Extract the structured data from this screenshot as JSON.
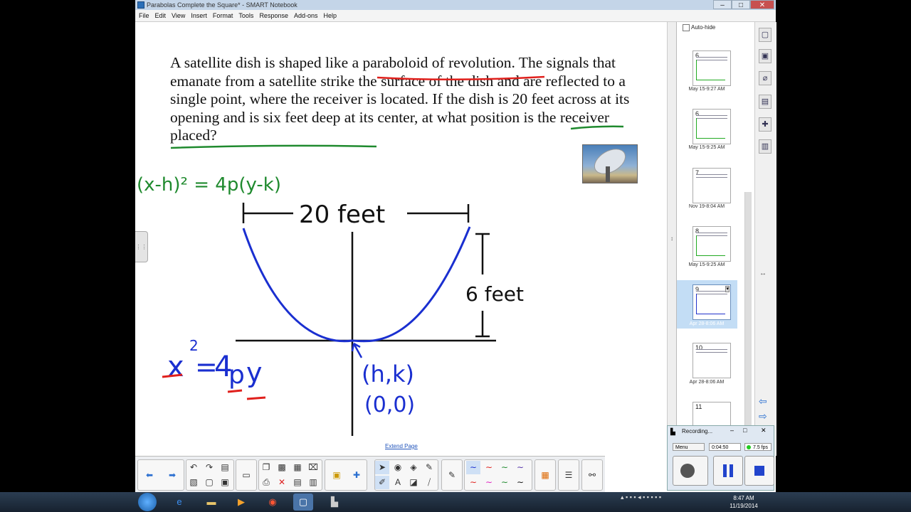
{
  "window": {
    "title": "Parabolas Complete the Square* - SMART Notebook",
    "minimize": "–",
    "maximize": "□",
    "close": "✕"
  },
  "menu": [
    "File",
    "Edit",
    "View",
    "Insert",
    "Format",
    "Tools",
    "Response",
    "Add-ons",
    "Help"
  ],
  "page": {
    "problem_text": "A satellite dish is shaped like a paraboloid of revolution. The signals that emanate from a satellite strike the surface of the dish and are reflected to a single point, where the receiver is located. If the dish is 20 feet across at its opening and is six feet deep at its center, at what position is the receiver placed?",
    "extend_page": "Extend Page",
    "handwriting": {
      "vertex_form": "(x-h)² = 4p(y-k)",
      "width_label": "20 feet",
      "depth_label": "6 feet",
      "standard_form_x": "x",
      "standard_form_exp": "2",
      "standard_form_eq": "=",
      "standard_form_4": "4",
      "standard_form_p": "p",
      "standard_form_y": "y",
      "vertex_hk": "(h,k)",
      "vertex_00": "(0,0)"
    },
    "colors": {
      "green": "#1f8a2e",
      "blue": "#1a2fd0",
      "red": "#e0201c",
      "black": "#111111"
    }
  },
  "sorter": {
    "autohide": "Auto-hide",
    "pages": [
      {
        "num": "6",
        "label": "May 15-9:27 AM"
      },
      {
        "num": "6",
        "label": "May 15-9:25 AM"
      },
      {
        "num": "7",
        "label": "Nov 19-8:04 AM"
      },
      {
        "num": "8",
        "label": "May 15-9:25 AM"
      },
      {
        "num": "9",
        "label": "Apr 28-8:06 AM"
      },
      {
        "num": "10",
        "label": "Apr 28-8:06 AM"
      },
      {
        "num": "11",
        "label": ""
      }
    ]
  },
  "recorder": {
    "title": "Recording...",
    "menu": "Menu",
    "time": "0:04:50",
    "fps": "7.5 fps"
  },
  "taskbar": {
    "time": "8:47 AM",
    "date": "11/19/2014"
  }
}
